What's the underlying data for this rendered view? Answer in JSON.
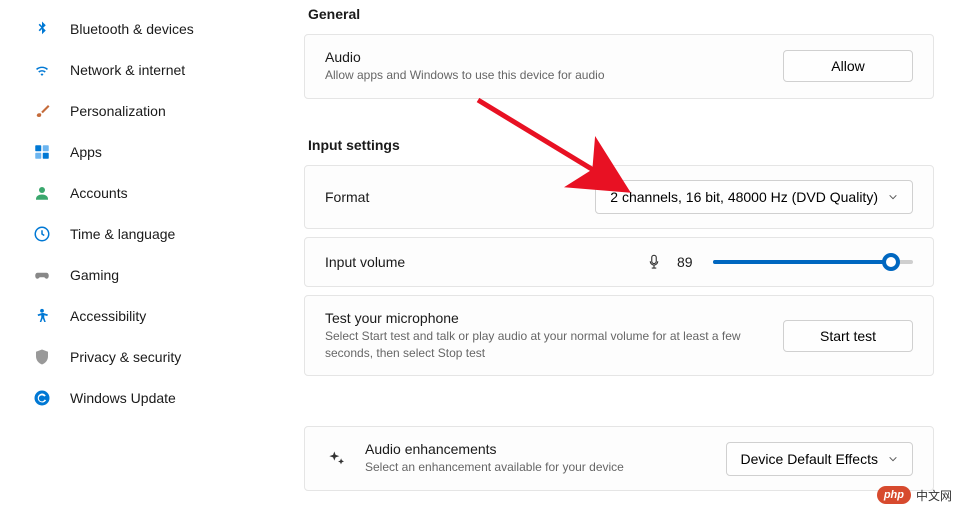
{
  "sidebar": {
    "items": [
      {
        "label": "Bluetooth & devices",
        "icon": "bluetooth",
        "color": "#0078d4"
      },
      {
        "label": "Network & internet",
        "icon": "wifi",
        "color": "#0078d4"
      },
      {
        "label": "Personalization",
        "icon": "brush",
        "color": "#c56b3a"
      },
      {
        "label": "Apps",
        "icon": "apps",
        "color": "#0078d4"
      },
      {
        "label": "Accounts",
        "icon": "person",
        "color": "#3aa76d"
      },
      {
        "label": "Time & language",
        "icon": "clock",
        "color": "#0078d4"
      },
      {
        "label": "Gaming",
        "icon": "gamepad",
        "color": "#888"
      },
      {
        "label": "Accessibility",
        "icon": "accessibility",
        "color": "#0078d4"
      },
      {
        "label": "Privacy & security",
        "icon": "shield",
        "color": "#999"
      },
      {
        "label": "Windows Update",
        "icon": "update",
        "color": "#0078d4"
      }
    ]
  },
  "sections": {
    "general": "General",
    "input": "Input settings"
  },
  "audio": {
    "title": "Audio",
    "sub": "Allow apps and Windows to use this device for audio",
    "btn": "Allow"
  },
  "format": {
    "label": "Format",
    "value": "2 channels, 16 bit, 48000 Hz (DVD Quality)"
  },
  "volume": {
    "label": "Input volume",
    "value": "89",
    "percent": 89
  },
  "test": {
    "title": "Test your microphone",
    "sub": "Select Start test and talk or play audio at your normal volume for at least a few seconds, then select Stop test",
    "btn": "Start test"
  },
  "enhance": {
    "title": "Audio enhancements",
    "sub": "Select an enhancement available for your device",
    "value": "Device Default Effects"
  },
  "watermark": {
    "badge": "php",
    "text": "中文网"
  }
}
